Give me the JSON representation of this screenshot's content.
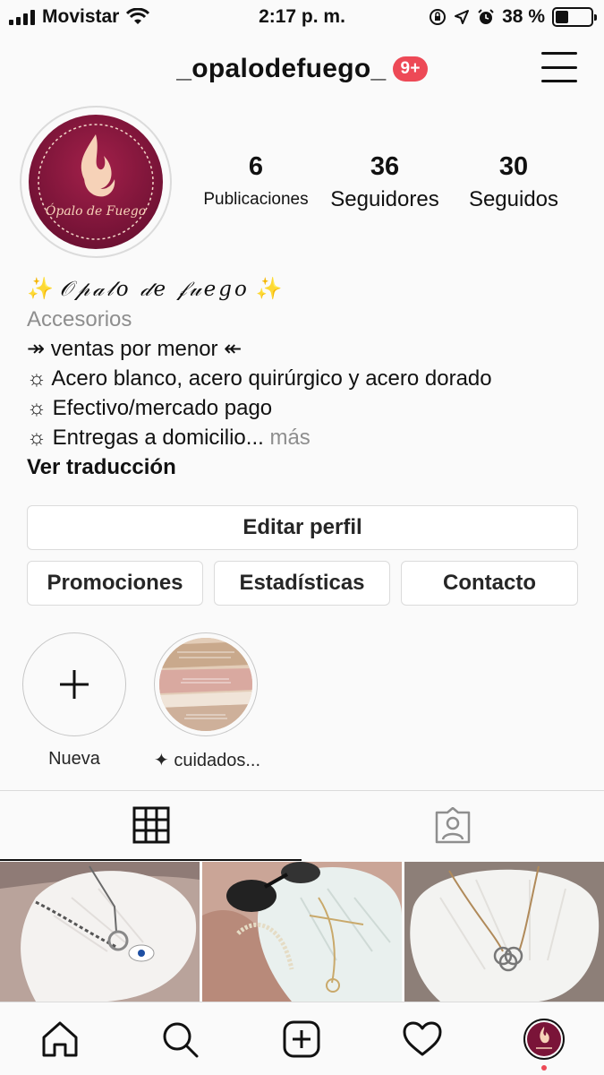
{
  "status_bar": {
    "carrier": "Movistar",
    "time": "2:17 p. m.",
    "battery": "38 %",
    "battery_level": 0.38
  },
  "header": {
    "username": "_opalodefuego_",
    "notification_badge": "9+"
  },
  "profile": {
    "avatar_text": "Ópalo de Fuego",
    "stats": [
      {
        "value": "6",
        "label": "Publicaciones"
      },
      {
        "value": "36",
        "label": "Seguidores"
      },
      {
        "value": "30",
        "label": "Seguidos"
      }
    ],
    "display_name": "𝒪𝓅𝒶𝓁𝑜 𝒹𝑒 𝒻𝓊𝑒𝑔𝑜",
    "category": "Accesorios",
    "bio_lines": [
      "↠ ventas por menor ↞",
      "☼ Acero blanco, acero quirúrgico y acero dorado",
      "☼ Efectivo/mercado pago",
      "☼ Entregas a domicilio..."
    ],
    "more_label": "más",
    "translate_label": "Ver traducción"
  },
  "buttons": {
    "edit_profile": "Editar perfil",
    "promotions": "Promociones",
    "statistics": "Estadísticas",
    "contact": "Contacto"
  },
  "highlights": [
    {
      "label": "Nueva"
    },
    {
      "label": "✦ cuidados..."
    }
  ],
  "colors": {
    "brand": "#7a1438",
    "badge": "#ed4956",
    "muted": "#8e8e8e",
    "border": "#dbdbdb"
  },
  "icons": {
    "tabs": [
      "grid-icon",
      "tagged-icon"
    ],
    "nav": [
      "home-icon",
      "search-icon",
      "add-post-icon",
      "heart-icon",
      "profile-avatar"
    ]
  }
}
